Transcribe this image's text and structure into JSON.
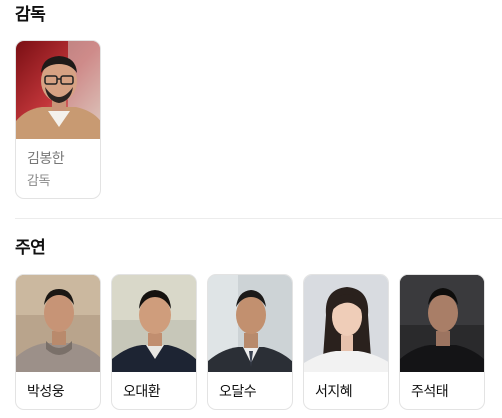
{
  "director_section": {
    "title": "감독",
    "people": [
      {
        "name": "김봉한",
        "role": "감독",
        "photo_icon": "director-portrait"
      }
    ]
  },
  "cast_section": {
    "title": "주연",
    "people": [
      {
        "name": "박성웅",
        "photo_icon": "actor-portrait"
      },
      {
        "name": "오대환",
        "photo_icon": "actor-portrait"
      },
      {
        "name": "오달수",
        "photo_icon": "actor-portrait"
      },
      {
        "name": "서지혜",
        "photo_icon": "actress-portrait"
      },
      {
        "name": "주석태",
        "photo_icon": "actor-portrait"
      }
    ]
  },
  "colors": {
    "card_border": "#e3e3e3",
    "divider": "#ececec",
    "title_text": "#111111",
    "muted_text": "#8a8a8a"
  }
}
